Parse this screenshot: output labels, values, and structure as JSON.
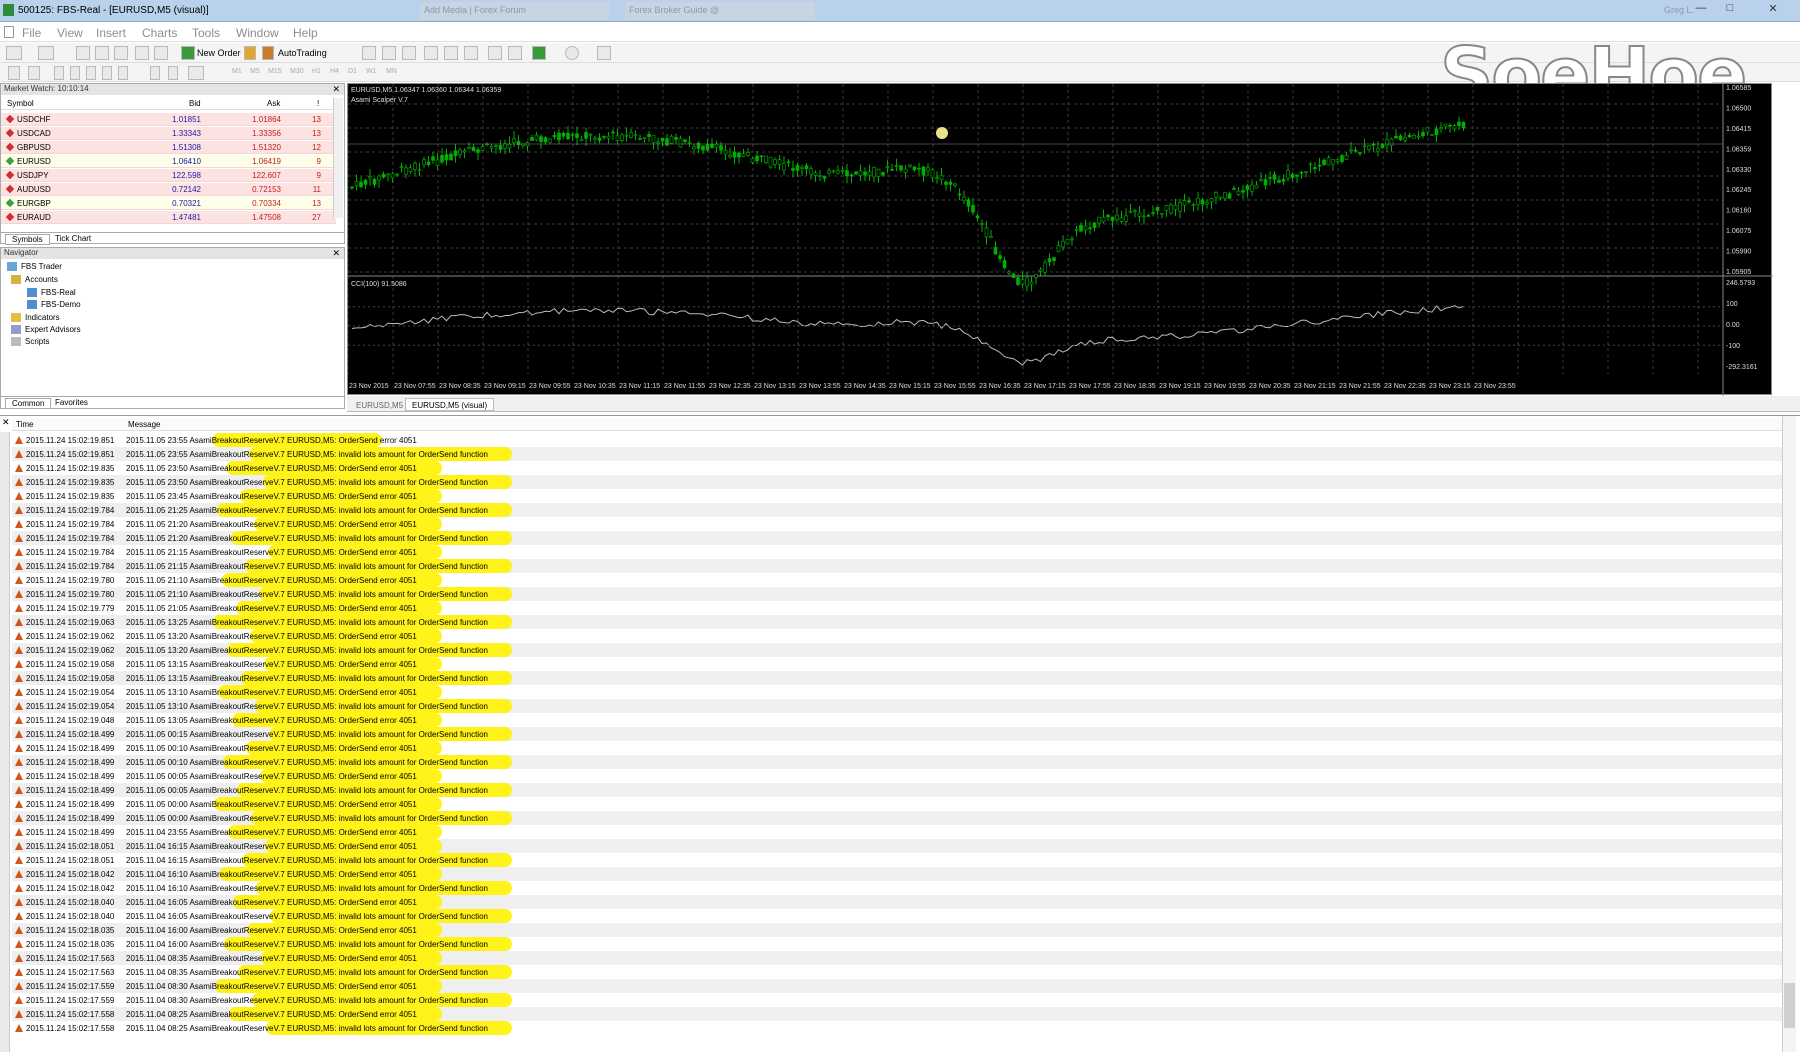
{
  "window": {
    "title": "500125: FBS-Real - [EURUSD,M5 (visual)]",
    "bg_tabs": [
      "Add Media | Forex Forum",
      "Forex Broker Guide @"
    ],
    "user": "Greg L."
  },
  "menu": [
    "File",
    "View",
    "Insert",
    "Charts",
    "Tools",
    "Window",
    "Help"
  ],
  "toolbar": {
    "new_order": "New Order",
    "autotrading": "AutoTrading",
    "timeframes": [
      "M1",
      "M5",
      "M15",
      "M30",
      "H1",
      "H4",
      "D1",
      "W1",
      "MN"
    ]
  },
  "logo_text": "SoeHoe",
  "market_watch": {
    "title": "Market Watch: 10:10:14",
    "columns": [
      "Symbol",
      "Bid",
      "Ask",
      "!"
    ],
    "rows": [
      {
        "symbol": "USDCHF",
        "bid": "1.01851",
        "ask": "1.01864",
        "spread": "13",
        "dir": "down"
      },
      {
        "symbol": "USDCAD",
        "bid": "1.33343",
        "ask": "1.33356",
        "spread": "13",
        "dir": "down"
      },
      {
        "symbol": "GBPUSD",
        "bid": "1.51308",
        "ask": "1.51320",
        "spread": "12",
        "dir": "down"
      },
      {
        "symbol": "EURUSD",
        "bid": "1.06410",
        "ask": "1.06419",
        "spread": "9",
        "dir": "up"
      },
      {
        "symbol": "USDJPY",
        "bid": "122.598",
        "ask": "122.607",
        "spread": "9",
        "dir": "down"
      },
      {
        "symbol": "AUDUSD",
        "bid": "0.72142",
        "ask": "0.72153",
        "spread": "11",
        "dir": "down"
      },
      {
        "symbol": "EURGBP",
        "bid": "0.70321",
        "ask": "0.70334",
        "spread": "13",
        "dir": "up"
      },
      {
        "symbol": "EURAUD",
        "bid": "1.47481",
        "ask": "1.47508",
        "spread": "27",
        "dir": "down"
      }
    ],
    "tabs": [
      "Symbols",
      "Tick Chart"
    ]
  },
  "navigator": {
    "title": "Navigator",
    "items": [
      "FBS Trader",
      "Accounts",
      "FBS-Real",
      "FBS-Demo",
      "Indicators",
      "Expert Advisors",
      "Scripts"
    ],
    "tabs": [
      "Common",
      "Favorites"
    ]
  },
  "chart": {
    "header": "EURUSD,M5 1.06347 1.06360 1.06344 1.06359",
    "ea": "Asami Scalper V.7",
    "price_labels": [
      "1.06585",
      "1.06500",
      "1.06415",
      "1.06359",
      "1.06330",
      "1.06245",
      "1.06160",
      "1.06075",
      "1.05990",
      "1.05905"
    ],
    "cci_header": "CCI(100) 91.5086",
    "cci_labels": [
      "246.5793",
      "100",
      "0.00",
      "-100",
      "-292.3161"
    ],
    "time_labels": [
      "23 Nov 2015",
      "23 Nov 07:55",
      "23 Nov 08:35",
      "23 Nov 09:15",
      "23 Nov 09:55",
      "23 Nov 10:35",
      "23 Nov 11:15",
      "23 Nov 11:55",
      "23 Nov 12:35",
      "23 Nov 13:15",
      "23 Nov 13:55",
      "23 Nov 14:35",
      "23 Nov 15:15",
      "23 Nov 15:55",
      "23 Nov 16:35",
      "23 Nov 17:15",
      "23 Nov 17:55",
      "23 Nov 18:35",
      "23 Nov 19:15",
      "23 Nov 19:55",
      "23 Nov 20:35",
      "23 Nov 21:15",
      "23 Nov 21:55",
      "23 Nov 22:35",
      "23 Nov 23:15",
      "23 Nov 23:55"
    ],
    "tabs": [
      "EURUSD,M5",
      "EURUSD,M5 (visual)"
    ],
    "colors": {
      "bull": "#00c000",
      "bear": "#00c000",
      "grid": "#555555",
      "bg": "#000000",
      "highlight": "#fff200"
    }
  },
  "journal": {
    "columns": [
      "Time",
      "Message"
    ],
    "rows": [
      {
        "time": "2015.11.24 15:02:19.851",
        "msg": "2015.11.05 23:55  AsamiBreakoutReserveV.7 EURUSD,M5: OrderSend error 4051"
      },
      {
        "time": "2015.11.24 15:02:19.851",
        "msg": "2015.11.05 23:55  AsamiBreakoutReserveV.7 EURUSD,M5: invalid lots amount for OrderSend function"
      },
      {
        "time": "2015.11.24 15:02:19.835",
        "msg": "2015.11.05 23:50  AsamiBreakoutReserveV.7 EURUSD,M5: OrderSend error 4051"
      },
      {
        "time": "2015.11.24 15:02:19.835",
        "msg": "2015.11.05 23:50  AsamiBreakoutReserveV.7 EURUSD,M5: invalid lots amount for OrderSend function"
      },
      {
        "time": "2015.11.24 15:02:19.835",
        "msg": "2015.11.05 23:45  AsamiBreakoutReserveV.7 EURUSD,M5: OrderSend error 4051"
      },
      {
        "time": "2015.11.24 15:02:19.784",
        "msg": "2015.11.05 21:25  AsamiBreakoutReserveV.7 EURUSD,M5: invalid lots amount for OrderSend function"
      },
      {
        "time": "2015.11.24 15:02:19.784",
        "msg": "2015.11.05 21:20  AsamiBreakoutReserveV.7 EURUSD,M5: OrderSend error 4051"
      },
      {
        "time": "2015.11.24 15:02:19.784",
        "msg": "2015.11.05 21:20  AsamiBreakoutReserveV.7 EURUSD,M5: invalid lots amount for OrderSend function"
      },
      {
        "time": "2015.11.24 15:02:19.784",
        "msg": "2015.11.05 21:15  AsamiBreakoutReserveV.7 EURUSD,M5: OrderSend error 4051"
      },
      {
        "time": "2015.11.24 15:02:19.784",
        "msg": "2015.11.05 21:15  AsamiBreakoutReserveV.7 EURUSD,M5: invalid lots amount for OrderSend function"
      },
      {
        "time": "2015.11.24 15:02:19.780",
        "msg": "2015.11.05 21:10  AsamiBreakoutReserveV.7 EURUSD,M5: OrderSend error 4051"
      },
      {
        "time": "2015.11.24 15:02:19.780",
        "msg": "2015.11.05 21:10  AsamiBreakoutReserveV.7 EURUSD,M5: invalid lots amount for OrderSend function"
      },
      {
        "time": "2015.11.24 15:02:19.779",
        "msg": "2015.11.05 21:05  AsamiBreakoutReserveV.7 EURUSD,M5: OrderSend error 4051"
      },
      {
        "time": "2015.11.24 15:02:19.063",
        "msg": "2015.11.05 13:25  AsamiBreakoutReserveV.7 EURUSD,M5: invalid lots amount for OrderSend function"
      },
      {
        "time": "2015.11.24 15:02:19.062",
        "msg": "2015.11.05 13:20  AsamiBreakoutReserveV.7 EURUSD,M5: OrderSend error 4051"
      },
      {
        "time": "2015.11.24 15:02:19.062",
        "msg": "2015.11.05 13:20  AsamiBreakoutReserveV.7 EURUSD,M5: invalid lots amount for OrderSend function"
      },
      {
        "time": "2015.11.24 15:02:19.058",
        "msg": "2015.11.05 13:15  AsamiBreakoutReserveV.7 EURUSD,M5: OrderSend error 4051"
      },
      {
        "time": "2015.11.24 15:02:19.058",
        "msg": "2015.11.05 13:15  AsamiBreakoutReserveV.7 EURUSD,M5: invalid lots amount for OrderSend function"
      },
      {
        "time": "2015.11.24 15:02:19.054",
        "msg": "2015.11.05 13:10  AsamiBreakoutReserveV.7 EURUSD,M5: OrderSend error 4051"
      },
      {
        "time": "2015.11.24 15:02:19.054",
        "msg": "2015.11.05 13:10  AsamiBreakoutReserveV.7 EURUSD,M5: invalid lots amount for OrderSend function"
      },
      {
        "time": "2015.11.24 15:02:19.048",
        "msg": "2015.11.05 13:05  AsamiBreakoutReserveV.7 EURUSD,M5: OrderSend error 4051"
      },
      {
        "time": "2015.11.24 15:02:18.499",
        "msg": "2015.11.05 00:15  AsamiBreakoutReserveV.7 EURUSD,M5: invalid lots amount for OrderSend function"
      },
      {
        "time": "2015.11.24 15:02:18.499",
        "msg": "2015.11.05 00:10  AsamiBreakoutReserveV.7 EURUSD,M5: OrderSend error 4051"
      },
      {
        "time": "2015.11.24 15:02:18.499",
        "msg": "2015.11.05 00:10  AsamiBreakoutReserveV.7 EURUSD,M5: invalid lots amount for OrderSend function"
      },
      {
        "time": "2015.11.24 15:02:18.499",
        "msg": "2015.11.05 00:05  AsamiBreakoutReserveV.7 EURUSD,M5: OrderSend error 4051"
      },
      {
        "time": "2015.11.24 15:02:18.499",
        "msg": "2015.11.05 00:05  AsamiBreakoutReserveV.7 EURUSD,M5: invalid lots amount for OrderSend function"
      },
      {
        "time": "2015.11.24 15:02:18.499",
        "msg": "2015.11.05 00:00  AsamiBreakoutReserveV.7 EURUSD,M5: OrderSend error 4051"
      },
      {
        "time": "2015.11.24 15:02:18.499",
        "msg": "2015.11.05 00:00  AsamiBreakoutReserveV.7 EURUSD,M5: invalid lots amount for OrderSend function"
      },
      {
        "time": "2015.11.24 15:02:18.499",
        "msg": "2015.11.04 23:55  AsamiBreakoutReserveV.7 EURUSD,M5: OrderSend error 4051"
      },
      {
        "time": "2015.11.24 15:02:18.051",
        "msg": "2015.11.04 16:15  AsamiBreakoutReserveV.7 EURUSD,M5: OrderSend error 4051"
      },
      {
        "time": "2015.11.24 15:02:18.051",
        "msg": "2015.11.04 16:15  AsamiBreakoutReserveV.7 EURUSD,M5: invalid lots amount for OrderSend function"
      },
      {
        "time": "2015.11.24 15:02:18.042",
        "msg": "2015.11.04 16:10  AsamiBreakoutReserveV.7 EURUSD,M5: OrderSend error 4051"
      },
      {
        "time": "2015.11.24 15:02:18.042",
        "msg": "2015.11.04 16:10  AsamiBreakoutReserveV.7 EURUSD,M5: invalid lots amount for OrderSend function"
      },
      {
        "time": "2015.11.24 15:02:18.040",
        "msg": "2015.11.04 16:05  AsamiBreakoutReserveV.7 EURUSD,M5: OrderSend error 4051"
      },
      {
        "time": "2015.11.24 15:02:18.040",
        "msg": "2015.11.04 16:05  AsamiBreakoutReserveV.7 EURUSD,M5: invalid lots amount for OrderSend function"
      },
      {
        "time": "2015.11.24 15:02:18.035",
        "msg": "2015.11.04 16:00  AsamiBreakoutReserveV.7 EURUSD,M5: OrderSend error 4051"
      },
      {
        "time": "2015.11.24 15:02:18.035",
        "msg": "2015.11.04 16:00  AsamiBreakoutReserveV.7 EURUSD,M5: invalid lots amount for OrderSend function"
      },
      {
        "time": "2015.11.24 15:02:17.563",
        "msg": "2015.11.04 08:35  AsamiBreakoutReserveV.7 EURUSD,M5: OrderSend error 4051"
      },
      {
        "time": "2015.11.24 15:02:17.563",
        "msg": "2015.11.04 08:35  AsamiBreakoutReserveV.7 EURUSD,M5: invalid lots amount for OrderSend function"
      },
      {
        "time": "2015.11.24 15:02:17.559",
        "msg": "2015.11.04 08:30  AsamiBreakoutReserveV.7 EURUSD,M5: OrderSend error 4051"
      },
      {
        "time": "2015.11.24 15:02:17.559",
        "msg": "2015.11.04 08:30  AsamiBreakoutReserveV.7 EURUSD,M5: invalid lots amount for OrderSend function"
      },
      {
        "time": "2015.11.24 15:02:17.558",
        "msg": "2015.11.04 08:25  AsamiBreakoutReserveV.7 EURUSD,M5: OrderSend error 4051"
      },
      {
        "time": "2015.11.24 15:02:17.558",
        "msg": "2015.11.04 08:25  AsamiBreakoutReserveV.7 EURUSD,M5: invalid lots amount for OrderSend function"
      }
    ]
  }
}
